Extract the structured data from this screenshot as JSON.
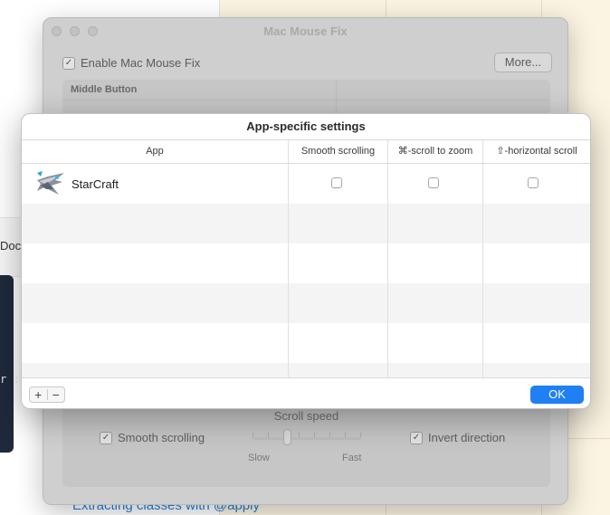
{
  "background": {
    "doc_fragment": "Doc",
    "code_fragment": "r :",
    "link_text": "Extracting classes with @apply"
  },
  "main_window": {
    "title": "Mac Mouse Fix",
    "enable_label": "Enable Mac Mouse Fix",
    "enable_checked": true,
    "more_button": "More...",
    "middle_button_header": "Middle Button",
    "scroll_speed_label": "Scroll speed",
    "smooth_scrolling_label": "Smooth scrolling",
    "smooth_scrolling_checked": true,
    "invert_direction_label": "Invert direction",
    "invert_direction_checked": true,
    "slider_slow": "Slow",
    "slider_fast": "Fast",
    "scroll_speed_value": 0.33
  },
  "sheet": {
    "title": "App-specific settings",
    "columns": {
      "app": "App",
      "smooth": "Smooth scrolling",
      "zoom": "⌘-scroll to zoom",
      "horizontal": "⇧-horizontal scroll"
    },
    "rows": [
      {
        "app_name": "StarCraft",
        "icon": "starcraft-app-icon",
        "smooth_scrolling": false,
        "cmd_scroll_zoom": false,
        "shift_horizontal_scroll": false
      }
    ],
    "add_button": "+",
    "remove_button": "−",
    "ok_button": "OK"
  },
  "colors": {
    "accent": "#1f7ff5",
    "alt_row": "#f4f4f5",
    "dim_window": "#cfcfcf"
  }
}
